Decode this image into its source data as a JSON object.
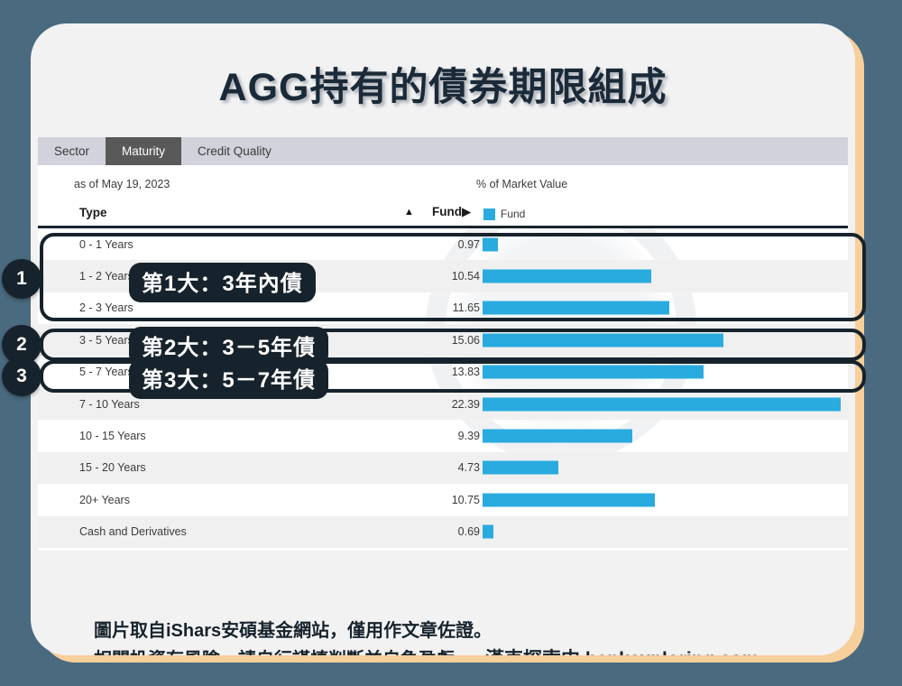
{
  "title": "AGG持有的債券期限組成",
  "tabs": [
    {
      "label": "Sector",
      "active": false
    },
    {
      "label": "Maturity",
      "active": true
    },
    {
      "label": "Credit Quality",
      "active": false
    }
  ],
  "meta": {
    "as_of": "as of May 19, 2023",
    "axis_label": "% of Market Value"
  },
  "table": {
    "col_type": "Type",
    "sort_arrow": "▲",
    "col_fund": "Fund▶",
    "legend_label": "Fund"
  },
  "annotations": {
    "badge1": "1",
    "badge2": "2",
    "badge3": "3",
    "pill1": "第1大：3年內債",
    "pill2": "第2大：3－5年債",
    "pill3": "第3大：5－7年債"
  },
  "footer": {
    "line1": "圖片取自iShars安碩基金網站，僅用作文章佐證。",
    "line2": "相關投資有風險，請自行謹慎判斷並自負盈虧",
    "brand": "漢克探索中 hankexploring.com"
  },
  "colors": {
    "bar": "#29abdf",
    "accent_dark": "#17232c",
    "page_bg": "#4a6a80",
    "card_shadow": "#f7cf9b",
    "tabbar": "#d2d2dc",
    "tab_active": "#595959"
  },
  "chart_data": {
    "type": "bar",
    "title": "AGG持有的債券期限組成",
    "subtitle": "as of May 19, 2023",
    "xlabel": "% of Market Value",
    "ylabel": "Type",
    "orientation": "horizontal",
    "grid": false,
    "legend": [
      "Fund"
    ],
    "legend_position": "top-right",
    "xlim": [
      0,
      22.39
    ],
    "categories": [
      "0 - 1 Years",
      "1 - 2 Years",
      "2 - 3 Years",
      "3 - 5 Years",
      "5 - 7 Years",
      "7 - 10 Years",
      "10 - 15 Years",
      "15 - 20 Years",
      "20+ Years",
      "Cash and Derivatives"
    ],
    "values": [
      0.97,
      10.54,
      11.65,
      15.06,
      13.83,
      22.39,
      9.39,
      4.73,
      10.75,
      0.69
    ],
    "series": [
      {
        "name": "Fund",
        "values": [
          0.97,
          10.54,
          11.65,
          15.06,
          13.83,
          22.39,
          9.39,
          4.73,
          10.75,
          0.69
        ]
      }
    ]
  }
}
